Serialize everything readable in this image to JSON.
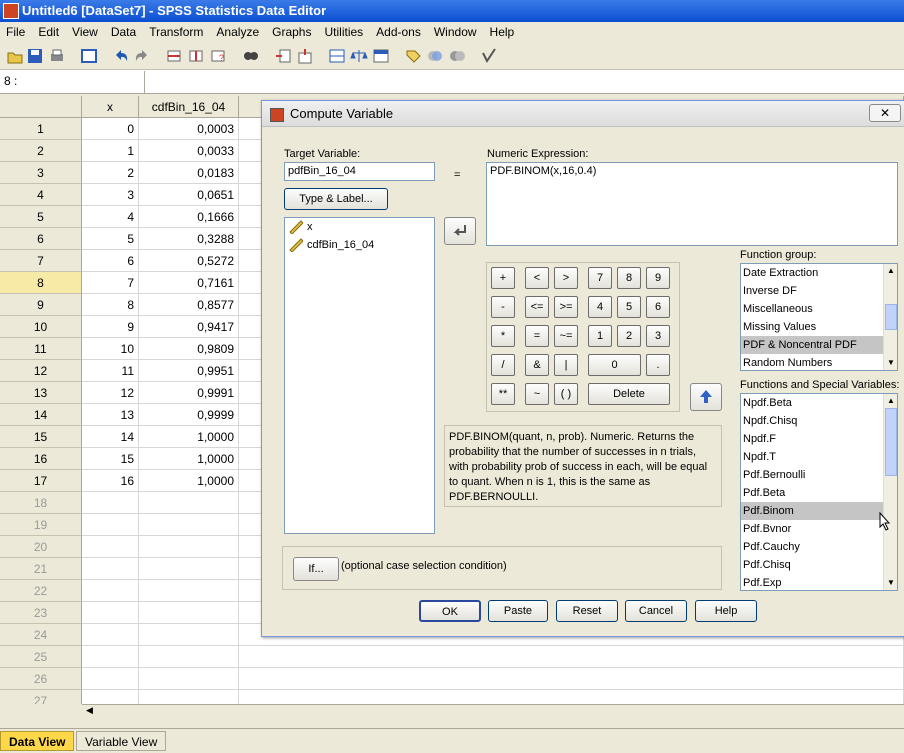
{
  "window": {
    "title": "Untitled6 [DataSet7] - SPSS Statistics Data Editor"
  },
  "menu": [
    "File",
    "Edit",
    "View",
    "Data",
    "Transform",
    "Analyze",
    "Graphs",
    "Utilities",
    "Add-ons",
    "Window",
    "Help"
  ],
  "toolbar_icons": [
    "open-icon",
    "save-icon",
    "print-icon",
    "dialog-recall-icon",
    "undo-icon",
    "redo-icon",
    "goto-case-icon",
    "goto-variable-icon",
    "variables-icon",
    "find-icon",
    "insert-cases-icon",
    "insert-variable-icon",
    "split-file-icon",
    "weight-cases-icon",
    "select-cases-icon",
    "value-labels-icon",
    "use-sets-icon",
    "show-all-variables-icon",
    "spell-check-icon"
  ],
  "cell_ref": "8 :",
  "grid": {
    "columns": [
      "x",
      "cdfBin_16_04"
    ],
    "rows": [
      {
        "n": "1",
        "x": "0",
        "v": "0,0003"
      },
      {
        "n": "2",
        "x": "1",
        "v": "0,0033"
      },
      {
        "n": "3",
        "x": "2",
        "v": "0,0183"
      },
      {
        "n": "4",
        "x": "3",
        "v": "0,0651"
      },
      {
        "n": "5",
        "x": "4",
        "v": "0,1666"
      },
      {
        "n": "6",
        "x": "5",
        "v": "0,3288"
      },
      {
        "n": "7",
        "x": "6",
        "v": "0,5272"
      },
      {
        "n": "8",
        "x": "7",
        "v": "0,7161"
      },
      {
        "n": "9",
        "x": "8",
        "v": "0,8577"
      },
      {
        "n": "10",
        "x": "9",
        "v": "0,9417"
      },
      {
        "n": "11",
        "x": "10",
        "v": "0,9809"
      },
      {
        "n": "12",
        "x": "11",
        "v": "0,9951"
      },
      {
        "n": "13",
        "x": "12",
        "v": "0,9991"
      },
      {
        "n": "14",
        "x": "13",
        "v": "0,9999"
      },
      {
        "n": "15",
        "x": "14",
        "v": "1,0000"
      },
      {
        "n": "16",
        "x": "15",
        "v": "1,0000"
      },
      {
        "n": "17",
        "x": "16",
        "v": "1,0000"
      }
    ],
    "empty_rows": [
      "18",
      "19",
      "20",
      "21",
      "22",
      "23",
      "24",
      "25",
      "26",
      "27"
    ]
  },
  "tabs": [
    "Data View",
    "Variable View"
  ],
  "dialog": {
    "title": "Compute Variable",
    "close": "✕",
    "target_label": "Target Variable:",
    "target_value": "pdfBin_16_04",
    "equals": "=",
    "type_label_button": "Type & Label...",
    "variables": [
      "x",
      "cdfBin_16_04"
    ],
    "expression_label": "Numeric Expression:",
    "expression": "PDF.BINOM(x,16,0.4)",
    "keypad": [
      "+",
      "<",
      ">",
      "7",
      "8",
      "9",
      "-",
      "<=",
      ">=",
      "4",
      "5",
      "6",
      "*",
      "=",
      "~=",
      "1",
      "2",
      "3",
      "/",
      "&",
      "|",
      "0",
      ".",
      "**",
      "~",
      "( )",
      "Delete"
    ],
    "function_group_label": "Function group:",
    "function_groups": [
      "Date Extraction",
      "Inverse DF",
      "Miscellaneous",
      "Missing Values",
      "PDF & Noncentral PDF",
      "Random Numbers"
    ],
    "function_group_selected": "PDF & Noncentral PDF",
    "functions_label": "Functions and Special Variables:",
    "functions": [
      "Npdf.Beta",
      "Npdf.Chisq",
      "Npdf.F",
      "Npdf.T",
      "Pdf.Bernoulli",
      "Pdf.Beta",
      "Pdf.Binom",
      "Pdf.Bvnor",
      "Pdf.Cauchy",
      "Pdf.Chisq",
      "Pdf.Exp"
    ],
    "function_selected": "Pdf.Binom",
    "description": "PDF.BINOM(quant, n, prob). Numeric. Returns the probability that the number of successes in n trials, with probability prob of success in each, will be equal to quant. When n is 1, this is the same as PDF.BERNOULLI.",
    "if_button": "If...",
    "if_text": "(optional case selection condition)",
    "buttons": [
      "OK",
      "Paste",
      "Reset",
      "Cancel",
      "Help"
    ]
  }
}
